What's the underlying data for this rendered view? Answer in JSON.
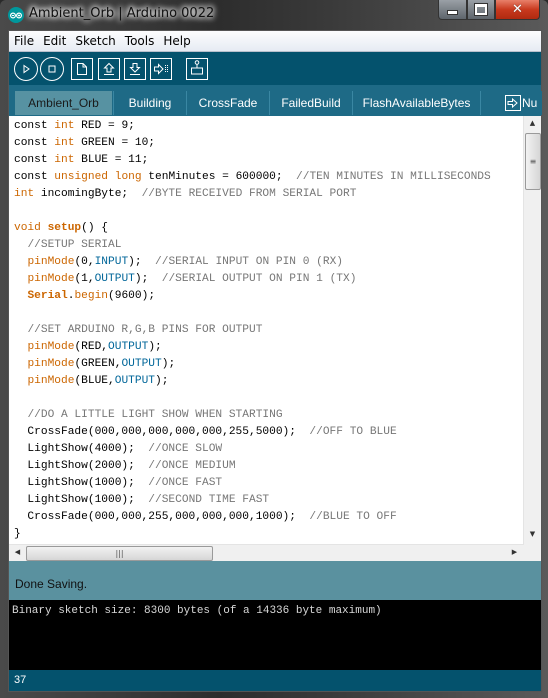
{
  "window": {
    "title": "Ambient_Orb | Arduino 0022",
    "app_icon": "arduino-logo-icon",
    "controls": [
      "minimize-icon",
      "maximize-icon",
      "close-icon"
    ]
  },
  "menu": {
    "items": [
      {
        "label": "File"
      },
      {
        "label": "Edit"
      },
      {
        "label": "Sketch"
      },
      {
        "label": "Tools"
      },
      {
        "label": "Help"
      }
    ]
  },
  "toolbar": {
    "buttons": [
      {
        "name": "verify",
        "icon": "play-icon"
      },
      {
        "name": "stop",
        "icon": "stop-icon"
      },
      {
        "name": "new",
        "icon": "new-file-icon"
      },
      {
        "name": "open",
        "icon": "open-arrow-up-icon"
      },
      {
        "name": "save",
        "icon": "save-arrow-down-icon"
      },
      {
        "name": "upload",
        "icon": "upload-icon"
      },
      {
        "name": "serial-monitor",
        "icon": "serial-monitor-icon"
      }
    ]
  },
  "tabs": {
    "items": [
      {
        "label": "Ambient_Orb",
        "active": true
      },
      {
        "label": "Building",
        "active": false
      },
      {
        "label": "CrossFade",
        "active": false
      },
      {
        "label": "FailedBuild",
        "active": false
      },
      {
        "label": "FlashAvailableBytes",
        "active": false
      }
    ],
    "overflow_label": "Nu",
    "overflow_icon": "tab-menu-arrow-icon"
  },
  "editor": {
    "lines": [
      [
        {
          "t": "const "
        },
        {
          "t": "int",
          "c": "kw"
        },
        {
          "t": " RED = 9;"
        }
      ],
      [
        {
          "t": "const "
        },
        {
          "t": "int",
          "c": "kw"
        },
        {
          "t": " GREEN = 10;"
        }
      ],
      [
        {
          "t": "const "
        },
        {
          "t": "int",
          "c": "kw"
        },
        {
          "t": " BLUE = 11;"
        }
      ],
      [
        {
          "t": "const "
        },
        {
          "t": "unsigned",
          "c": "kw"
        },
        {
          "t": " "
        },
        {
          "t": "long",
          "c": "kw"
        },
        {
          "t": " tenMinutes = 600000;  "
        },
        {
          "t": "//TEN MINUTES IN MILLISECONDS",
          "c": "cmt"
        }
      ],
      [
        {
          "t": "int",
          "c": "kw"
        },
        {
          "t": " incomingByte;  "
        },
        {
          "t": "//BYTE RECEIVED FROM SERIAL PORT",
          "c": "cmt"
        }
      ],
      [],
      [
        {
          "t": "void",
          "c": "kw"
        },
        {
          "t": " "
        },
        {
          "t": "setup",
          "c": "kwb"
        },
        {
          "t": "() {"
        }
      ],
      [
        {
          "t": "  "
        },
        {
          "t": "//SETUP SERIAL",
          "c": "cmt"
        }
      ],
      [
        {
          "t": "  "
        },
        {
          "t": "pinMode",
          "c": "kw"
        },
        {
          "t": "(0,"
        },
        {
          "t": "INPUT",
          "c": "const"
        },
        {
          "t": ");  "
        },
        {
          "t": "//SERIAL INPUT ON PIN 0 (RX)",
          "c": "cmt"
        }
      ],
      [
        {
          "t": "  "
        },
        {
          "t": "pinMode",
          "c": "kw"
        },
        {
          "t": "(1,"
        },
        {
          "t": "OUTPUT",
          "c": "const"
        },
        {
          "t": ");  "
        },
        {
          "t": "//SERIAL OUTPUT ON PIN 1 (TX)",
          "c": "cmt"
        }
      ],
      [
        {
          "t": "  "
        },
        {
          "t": "Serial",
          "c": "kwb"
        },
        {
          "t": "."
        },
        {
          "t": "begin",
          "c": "kw"
        },
        {
          "t": "(9600);"
        }
      ],
      [],
      [
        {
          "t": "  "
        },
        {
          "t": "//SET ARDUINO R,G,B PINS FOR OUTPUT",
          "c": "cmt"
        }
      ],
      [
        {
          "t": "  "
        },
        {
          "t": "pinMode",
          "c": "kw"
        },
        {
          "t": "(RED,"
        },
        {
          "t": "OUTPUT",
          "c": "const"
        },
        {
          "t": ");"
        }
      ],
      [
        {
          "t": "  "
        },
        {
          "t": "pinMode",
          "c": "kw"
        },
        {
          "t": "(GREEN,"
        },
        {
          "t": "OUTPUT",
          "c": "const"
        },
        {
          "t": ");"
        }
      ],
      [
        {
          "t": "  "
        },
        {
          "t": "pinMode",
          "c": "kw"
        },
        {
          "t": "(BLUE,"
        },
        {
          "t": "OUTPUT",
          "c": "const"
        },
        {
          "t": ");"
        }
      ],
      [],
      [
        {
          "t": "  "
        },
        {
          "t": "//DO A LITTLE LIGHT SHOW WHEN STARTING",
          "c": "cmt"
        }
      ],
      [
        {
          "t": "  CrossFade(000,000,000,000,000,255,5000);  "
        },
        {
          "t": "//OFF TO BLUE",
          "c": "cmt"
        }
      ],
      [
        {
          "t": "  LightShow(4000);  "
        },
        {
          "t": "//ONCE SLOW",
          "c": "cmt"
        }
      ],
      [
        {
          "t": "  LightShow(2000);  "
        },
        {
          "t": "//ONCE MEDIUM",
          "c": "cmt"
        }
      ],
      [
        {
          "t": "  LightShow(1000);  "
        },
        {
          "t": "//ONCE FAST",
          "c": "cmt"
        }
      ],
      [
        {
          "t": "  LightShow(1000);  "
        },
        {
          "t": "//SECOND TIME FAST",
          "c": "cmt"
        }
      ],
      [
        {
          "t": "  CrossFade(000,000,255,000,000,000,1000);  "
        },
        {
          "t": "//BLUE TO OFF",
          "c": "cmt"
        }
      ],
      [
        {
          "t": "}"
        }
      ]
    ]
  },
  "status": {
    "message": "Done Saving."
  },
  "console": {
    "output": "Binary sketch size: 8300 bytes (of a 14336 byte maximum)"
  },
  "footer": {
    "line_number": "37"
  },
  "colors": {
    "toolbar_bg": "#04526d",
    "tabs_bg": "#1e6a86",
    "active_tab_bg": "#5792a2",
    "status_bg": "#5a919f",
    "keyword": "#cc6600",
    "constant": "#006699",
    "comment": "#777777",
    "console_bg": "#000000"
  }
}
